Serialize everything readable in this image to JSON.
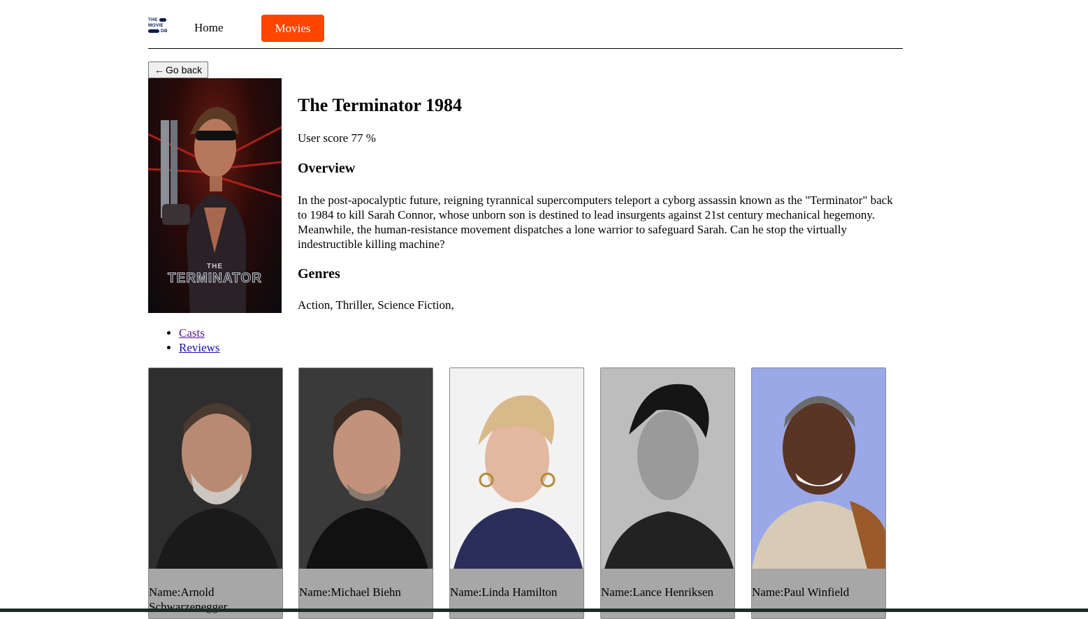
{
  "header": {
    "logo": {
      "line1": "THE",
      "line2": "MOVIE",
      "line3": "DB"
    },
    "home_label": "Home",
    "movies_label": "Movies",
    "accent_color": "#ff4500"
  },
  "go_back": {
    "arrow": "←",
    "label": "Go back"
  },
  "movie": {
    "title": "The Terminator 1984",
    "user_score": "User score 77 %",
    "overview_heading": "Overview",
    "overview": "In the post-apocalyptic future, reigning tyrannical supercomputers teleport a cyborg assassin known as the \"Terminator\" back to 1984 to kill Sarah Connor, whose unborn son is destined to lead insurgents against 21st century mechanical hegemony. Meanwhile, the human-resistance movement dispatches a lone warrior to safeguard Sarah. Can he stop the virtually indestructible killing machine?",
    "genres_heading": "Genres",
    "genres": "Action, Thriller, Science Fiction,",
    "poster_text_small": "THE",
    "poster_text_large": "TERMINATOR"
  },
  "subnav": [
    {
      "label": "Casts"
    },
    {
      "label": "Reviews"
    }
  ],
  "cast": [
    {
      "name": "Name:Arnold Schwarzenegger",
      "bg": "#2e2e2e"
    },
    {
      "name": "Name:Michael Biehn",
      "bg": "#3a3a3a"
    },
    {
      "name": "Name:Linda Hamilton",
      "bg": "#f2f2f2"
    },
    {
      "name": "Name:Lance Henriksen",
      "bg": "#bdbdbd"
    },
    {
      "name": "Name:Paul Winfield",
      "bg": "#9aa8e8"
    }
  ]
}
